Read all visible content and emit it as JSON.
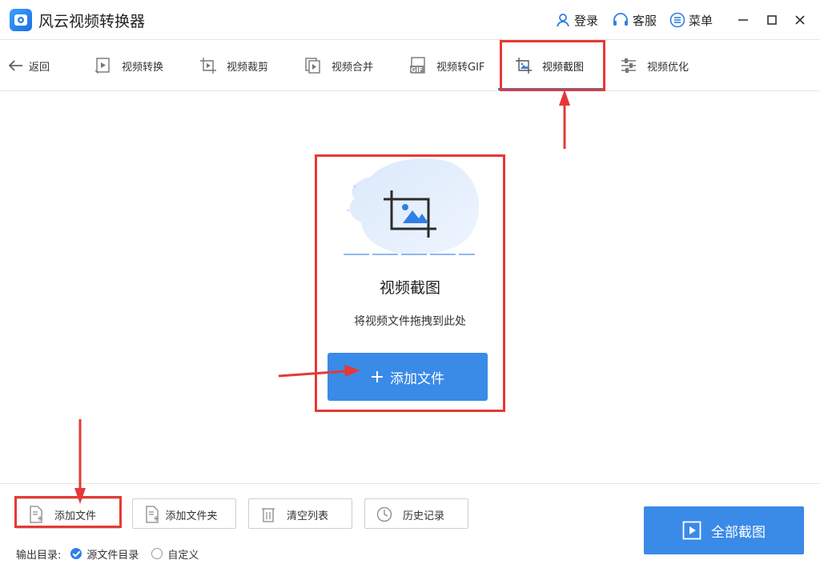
{
  "app": {
    "title": "风云视频转换器"
  },
  "header": {
    "login_label": "登录",
    "service_label": "客服",
    "menu_label": "菜单"
  },
  "toolbar": {
    "back_label": "返回",
    "tools": [
      {
        "label": "视频转换",
        "icon": "video-convert-icon"
      },
      {
        "label": "视频裁剪",
        "icon": "video-crop-icon"
      },
      {
        "label": "视频合并",
        "icon": "video-merge-icon"
      },
      {
        "label": "视频转GIF",
        "icon": "gif-icon"
      },
      {
        "label": "视频截图",
        "icon": "screenshot-icon",
        "active": true
      },
      {
        "label": "视频优化",
        "icon": "optimize-icon"
      }
    ],
    "gif_badge": "GIF"
  },
  "drop": {
    "title": "视频截图",
    "hint": "将视频文件拖拽到此处",
    "add_label": "添加文件"
  },
  "bottom": {
    "buttons": [
      {
        "label": "添加文件",
        "icon": "file-add-icon"
      },
      {
        "label": "添加文件夹",
        "icon": "folder-add-icon"
      },
      {
        "label": "清空列表",
        "icon": "trash-icon"
      },
      {
        "label": "历史记录",
        "icon": "clock-icon"
      }
    ],
    "output_label": "输出目录:",
    "output_options": [
      {
        "label": "源文件目录",
        "checked": true
      },
      {
        "label": "自定义",
        "checked": false
      }
    ],
    "action_label": "全部截图"
  },
  "colors": {
    "accent": "#3a8ae8",
    "annotation": "#e53935"
  }
}
